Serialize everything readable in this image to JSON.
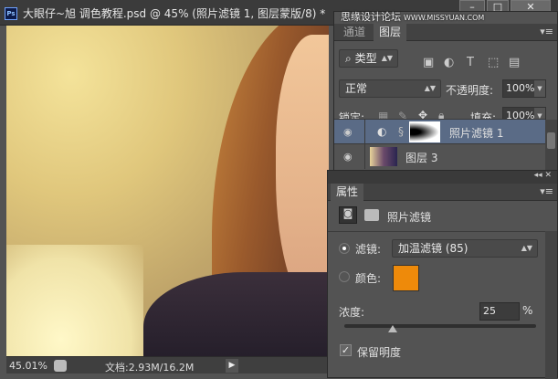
{
  "window": {
    "app_icon": "Ps",
    "title": "大眼仔~旭 调色教程.psd @ 45% (照片滤镜 1, 图层蒙版/8) *",
    "watermark": "思缘设计论坛",
    "watermark_url": "WWW.MISSYUAN.COM",
    "minimize": "–",
    "maximize": "□",
    "close": "✕"
  },
  "status": {
    "zoom": "45.01%",
    "doc_info": "文档:2.93M/16.2M",
    "arrow": "▶"
  },
  "layers_panel": {
    "tabs": [
      "通道",
      "图层"
    ],
    "active_tab": 1,
    "menu": "▾≡",
    "filter_kind": "类型",
    "filter_icon": "⌕",
    "blend_mode": "正常",
    "opacity_label": "不透明度:",
    "opacity": "100%",
    "lock_label": "锁定:",
    "fill_label": "填充:",
    "fill": "100%",
    "layers": [
      {
        "name": "照片滤镜 1",
        "selected": true
      },
      {
        "name": "图层 3",
        "selected": false
      }
    ],
    "collapse": "◂◂ ✕"
  },
  "properties_panel": {
    "header_controls": "◂◂ ✕",
    "tab": "属性",
    "menu": "▾≡",
    "title": "照片滤镜",
    "filter_label": "滤镜:",
    "filter_value": "加温滤镜 (85)",
    "filter_selected": true,
    "color_label": "颜色:",
    "color": "#ee8a0a",
    "density_label": "浓度:",
    "density": "25",
    "density_unit": "%",
    "density_fraction": 0.25,
    "preserve_label": "保留明度",
    "preserve_checked": true
  }
}
